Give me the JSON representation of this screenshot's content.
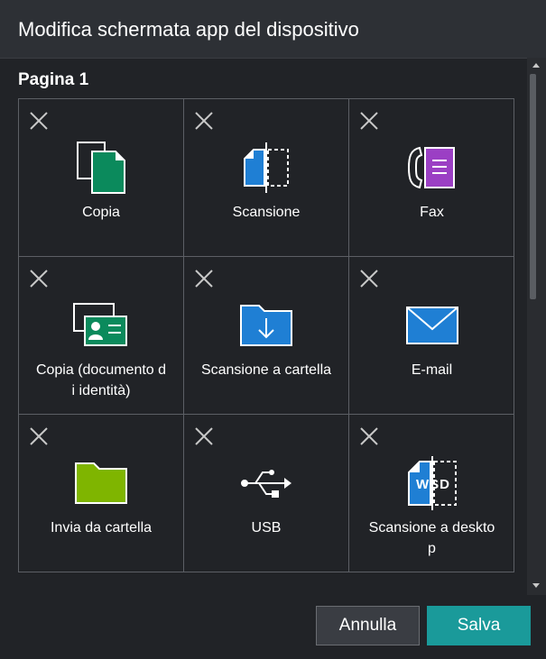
{
  "dialog": {
    "title": "Modifica schermata app del dispositivo",
    "page_label": "Pagina 1",
    "tiles": [
      {
        "label": "Copia",
        "icon": "copy-icon"
      },
      {
        "label": "Scansione",
        "icon": "scan-icon"
      },
      {
        "label": "Fax",
        "icon": "fax-icon"
      },
      {
        "label": "Copia (documento d\ni identità)",
        "icon": "id-copy-icon"
      },
      {
        "label": "Scansione a cartella",
        "icon": "scan-to-folder-icon"
      },
      {
        "label": "E-mail",
        "icon": "email-icon"
      },
      {
        "label": "Invia da cartella",
        "icon": "send-from-folder-icon"
      },
      {
        "label": "USB",
        "icon": "usb-icon"
      },
      {
        "label": "Scansione a deskto\np",
        "icon": "scan-to-desktop-icon"
      }
    ],
    "wsd_text": "WSD",
    "buttons": {
      "cancel": "Annulla",
      "save": "Salva"
    },
    "colors": {
      "accent": "#1a9a9a",
      "copy_green": "#0b8a5c",
      "scan_blue": "#1f7fd4",
      "fax_purple": "#9b3fc4",
      "folder_green": "#7fb500",
      "email_blue": "#1f7fd4"
    }
  }
}
